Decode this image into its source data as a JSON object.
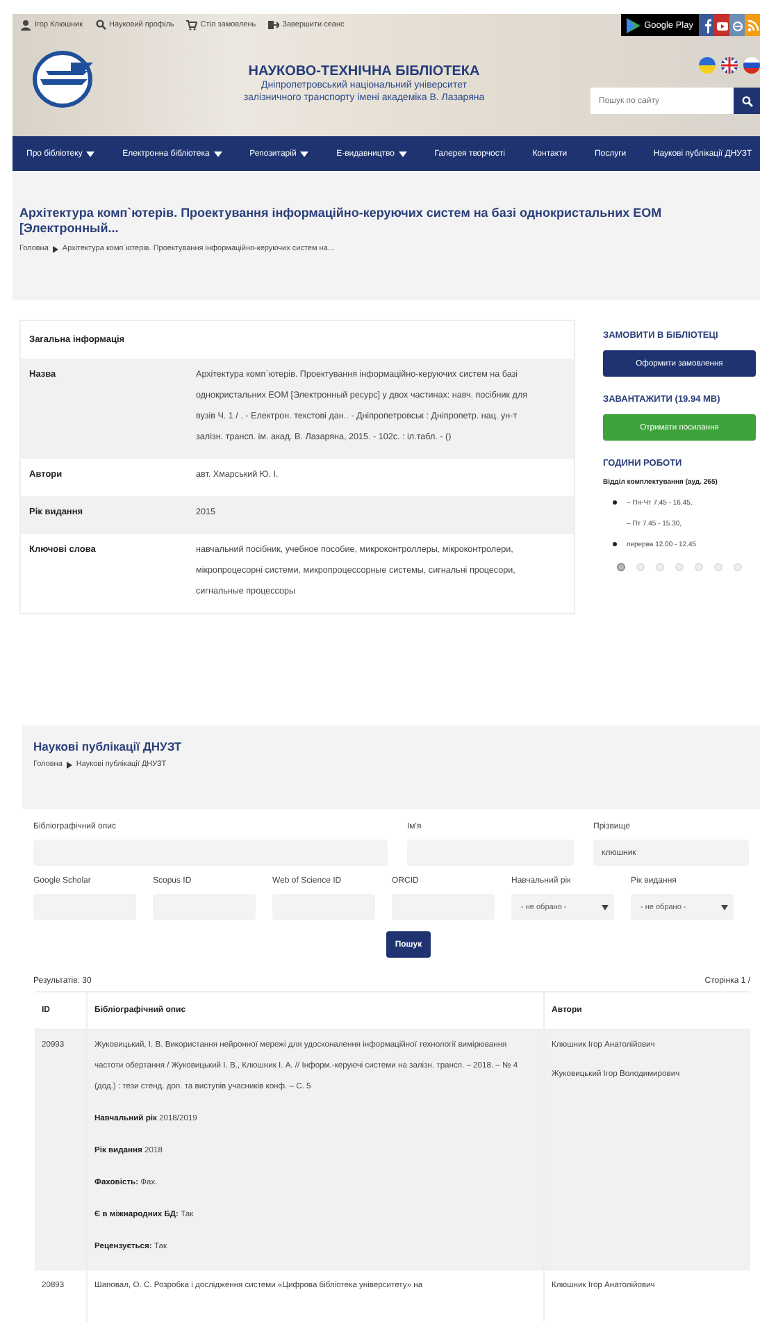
{
  "top_bar": {
    "links": [
      {
        "kind": "user",
        "text": "Ігор Клюшник"
      },
      {
        "kind": "search",
        "text": "Науковий профіль"
      },
      {
        "kind": "cart",
        "text": "Стіл замовлень"
      },
      {
        "kind": "logout",
        "text": "Завершити сеанс"
      }
    ],
    "store_badge": {
      "text": "Google Play"
    },
    "social": [
      {
        "kind": "facebook",
        "color": "#3b5998"
      },
      {
        "kind": "youtube",
        "color": "#c4302b"
      },
      {
        "kind": "other",
        "color": "#6d8fb3"
      },
      {
        "kind": "rss",
        "color": "#f39c12"
      }
    ]
  },
  "header": {
    "title": "НАУКОВО-ТЕХНІЧНА БІБЛІОТЕКА",
    "subtitle": [
      "Дніпропетровський національний університет",
      "залізничного транспорту імені академіка В. Лазаряна"
    ],
    "languages": [
      {
        "kind": "uk"
      },
      {
        "kind": "en"
      },
      {
        "kind": "ru"
      }
    ],
    "search": {
      "placeholder": "Пошук по сайту"
    }
  },
  "nav": [
    {
      "label": "Про бібліотеку",
      "dropdown": true
    },
    {
      "label": "Електронна бібліотека",
      "dropdown": true
    },
    {
      "label": "Репозитарій",
      "dropdown": true
    },
    {
      "label": "Е-видавництво",
      "dropdown": true
    },
    {
      "label": "Галерея творчості",
      "dropdown": false
    },
    {
      "label": "Контакти",
      "dropdown": false
    },
    {
      "label": "Послуги",
      "dropdown": false
    },
    {
      "label": "Наукові публікації ДНУЗТ",
      "dropdown": false
    }
  ],
  "record_page": {
    "title": "Архітектура комп`ютерів. Проектування інформаційно-керуючих систем на базі однокристальних ЕОМ [Электронный...",
    "breadcrumb": [
      "Головна",
      "Архітектура комп`ютерів. Проектування інформаційно-керуючих систем на..."
    ],
    "table": {
      "heading": "Загальна інформація",
      "rows": [
        {
          "label": "Назва",
          "value": "Архітектура комп`ютерів. Проектування інформаційно-керуючих систем на базі однокристальних ЕОМ [Электронный ресурс] у двох частинах: навч. посібник для вузів Ч. 1 / . - Електрон. текстові дан.. - Дніпропетровськ : Дніпропетр. нац. ун-т залізн. трансп. ім. акад. В. Лазаряна, 2015. - 102с. : іл.табл. - ()"
        },
        {
          "label": "Автори",
          "value": "авт. Хмарський Ю. І."
        },
        {
          "label": "Рік видання",
          "value": "2015"
        },
        {
          "label": "Ключові слова",
          "value": "навчальний посібник, учебное пособие, микроконтроллеры, мікроконтролери, мікропроцесорні системи, микропроцессорные системы, сигнальні процесори, сигнальные процессоры"
        }
      ]
    },
    "sidebar": {
      "order_heading": "ЗАМОВИТИ В БІБЛІОТЕЦІ",
      "order_button": "Оформити замовлення",
      "download_heading": "ЗАВАНТАЖИТИ (19.94 MB)",
      "download_button": "Отримати посилання",
      "hours_heading": "ГОДИНИ РОБОТИ",
      "department": "Відділ комплектування (ауд. 265)",
      "hours": [
        {
          "text": "– Пн-Чт 7.45 - 16.45,",
          "bullet": true
        },
        {
          "text": "– Пт 7.45 - 15.30,",
          "bullet": false
        },
        {
          "text": "перерва 12.00 - 12.45",
          "bullet": true
        }
      ],
      "slides": [
        {
          "selected": true
        },
        {
          "selected": false
        },
        {
          "selected": false
        },
        {
          "selected": false
        },
        {
          "selected": false
        },
        {
          "selected": false
        },
        {
          "selected": false
        }
      ]
    }
  },
  "search_page": {
    "title": "Наукові публікації ДНУЗТ",
    "breadcrumb": [
      "Головна",
      "Наукові публікації ДНУЗТ"
    ],
    "fields_row1": [
      {
        "kind": "text",
        "label": "Бібліографічний опис"
      },
      {
        "kind": "text",
        "label": "Ім'я"
      },
      {
        "kind": "text",
        "label": "Прізвище",
        "value": "клюшник"
      }
    ],
    "fields_row2": [
      {
        "kind": "text",
        "label": "Google Scholar"
      },
      {
        "kind": "text",
        "label": "Scopus ID"
      },
      {
        "kind": "text",
        "label": "Web of Science ID"
      },
      {
        "kind": "text",
        "label": "ORCID"
      },
      {
        "kind": "select",
        "label": "Навчальний рік",
        "value": "- не обрано -"
      },
      {
        "kind": "select",
        "label": "Рік видання",
        "value": "- не обрано -"
      }
    ],
    "search_button": "Пошук",
    "results_count": "Результатів: 30",
    "page_info": "Сторінка 1 /",
    "table": {
      "columns": [
        "ID",
        "Бібліографічний опис",
        "Автори"
      ],
      "rows": [
        {
          "id": "20993",
          "description": "Жуковицький, І. В. Використання нейронної мережі для удосконалення інформаційної технології вимірювання частоти обертання / Жуковицький І. В., Клюшник І. А. // Інформ.-керуючі системи на залізн. трансп. – 2018. – № 4 (дод.) : тези стенд. доп. та виступів учасників конф. – С. 5",
          "details": [
            {
              "label": "Навчальний рік",
              "value": "2018/2019"
            },
            {
              "label": "Рік видання",
              "value": "2018"
            },
            {
              "label": "Фаховість:",
              "value": "Фах."
            },
            {
              "label": "Є в міжнародних БД:",
              "value": "Так"
            },
            {
              "label": "Рецензується:",
              "value": "Так"
            }
          ],
          "authors": [
            "Клюшник Ігор Анатолійович",
            "Жуковицький Ігор Володимирович"
          ]
        },
        {
          "id": "20893",
          "description": "Шаповал, О. С. Розробка і дослідження системи «Цифрова бібліотека університету» на",
          "details": [],
          "authors": [
            "Клюшник Ігор Анатолійович"
          ]
        }
      ]
    }
  }
}
